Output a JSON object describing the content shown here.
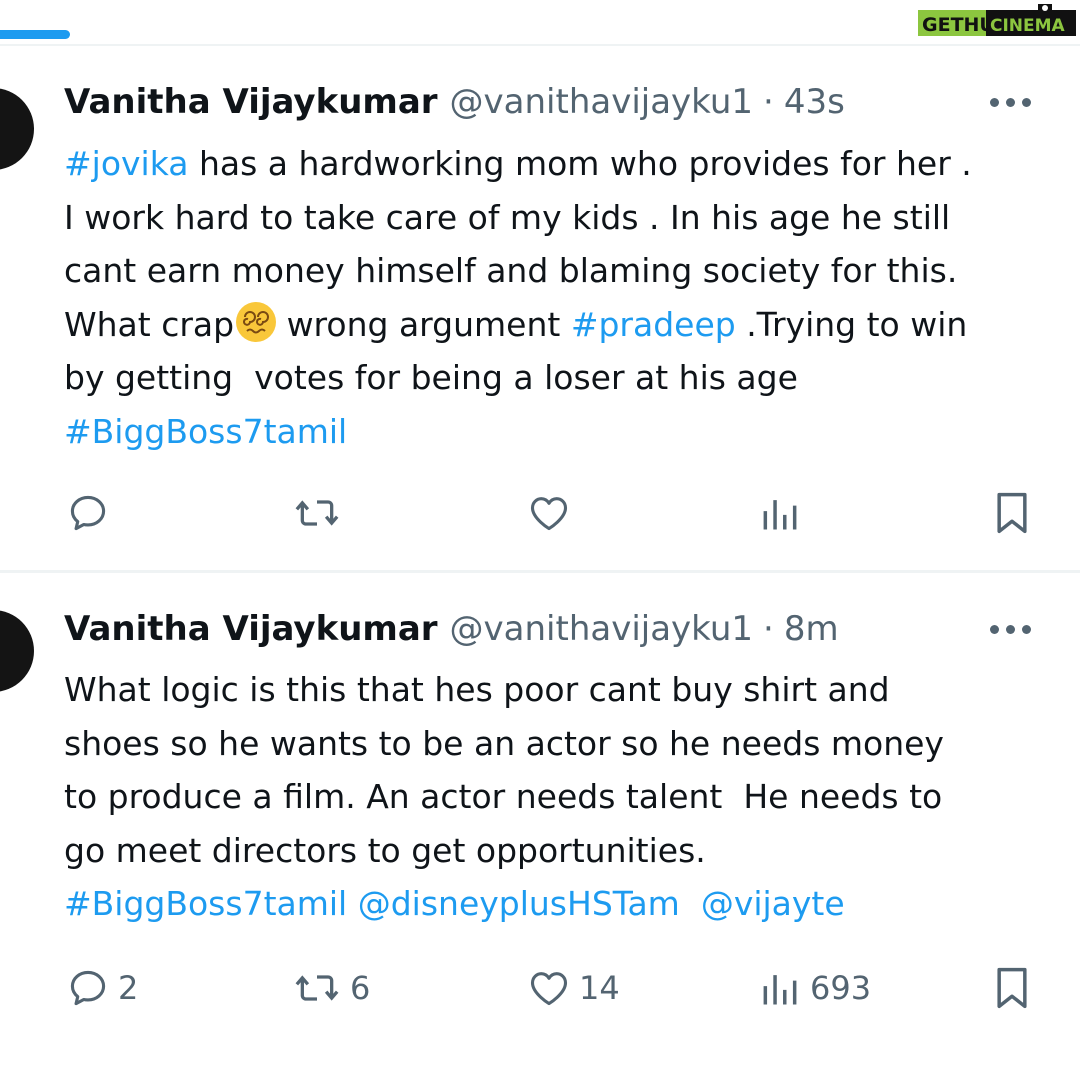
{
  "watermark": {
    "part1": "GETHU",
    "part2": "CINEMA"
  },
  "tweets": [
    {
      "name": "Vanitha Vijaykumar",
      "handle": "@vanithavijayku1",
      "dot": "·",
      "time": "43s",
      "line1_tag": "#jovika",
      "line1_rest": " has a hardworking mom who provides for her .",
      "line2": "I work hard to take care of my kids . In his age he still",
      "line3": "cant earn money himself and blaming society for this.",
      "line4_a": "What crap",
      "line4_b": " wrong argument ",
      "line4_tag": "#pradeep",
      "line4_c": " .Trying to win",
      "line5": "by getting  votes for being a loser at his age",
      "line6_tag": "#BiggBoss7tamil",
      "emoji": "dizzy-face-emoji",
      "icons": [
        "reply-icon",
        "retweet-icon",
        "like-icon",
        "views-icon",
        "bookmark-icon"
      ]
    },
    {
      "name": "Vanitha Vijaykumar",
      "handle": "@vanithavijayku1",
      "dot": "·",
      "time": "8m",
      "line1": "What logic is this that hes poor cant buy shirt and",
      "line2": "shoes so he wants to be an actor so he needs money",
      "line3": "to produce a film. An actor needs talent  He needs to",
      "line4": "go meet directors to get opportunities.",
      "line5_tag1": "#BiggBoss7tamil",
      "line5_mention1": "@disneyplusHSTam",
      "line5_mention2": "@vijayte",
      "replies": "2",
      "retweets": "6",
      "likes": "14",
      "views": "693",
      "icons": [
        "reply-icon",
        "retweet-icon",
        "like-icon",
        "views-icon",
        "bookmark-icon"
      ]
    }
  ],
  "colors": {
    "accent": "#1d9bf0",
    "text": "#0f1419",
    "muted": "#536471",
    "divider": "#eff3f4",
    "watermark_green": "#8cc63f"
  }
}
